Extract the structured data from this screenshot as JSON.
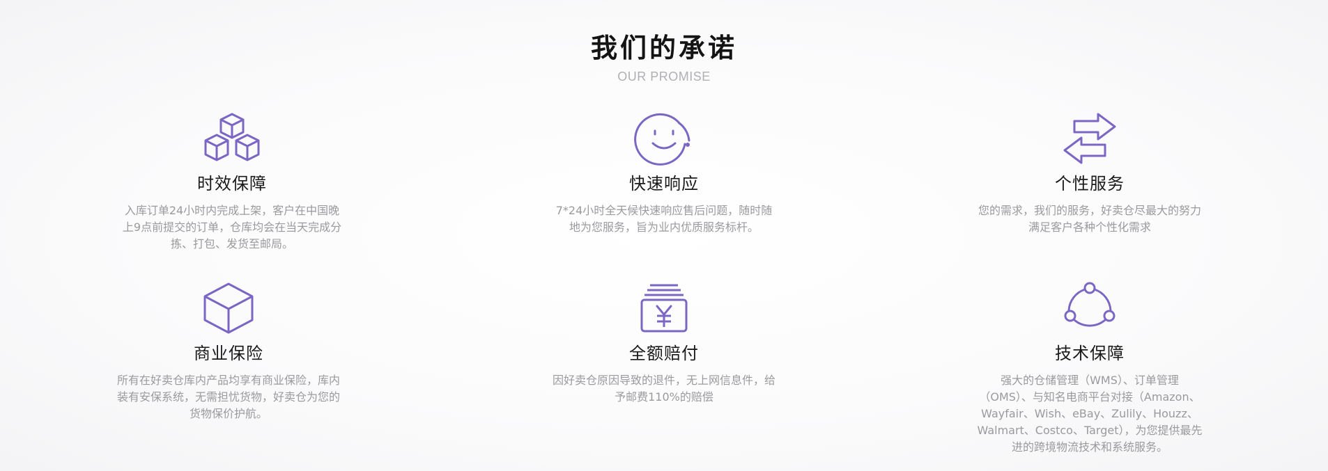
{
  "header": {
    "title": "我们的承诺",
    "subtitle": "OUR PROMISE"
  },
  "accent_color": "#7b66c4",
  "cards": [
    {
      "icon": "cubes-icon",
      "title": "时效保障",
      "description": "入库订单24小时内完成上架，客户在中国晚上9点前提交的订单，仓库均会在当天完成分拣、打包、发货至邮局。"
    },
    {
      "icon": "smiley-face-icon",
      "title": "快速响应",
      "description": "7*24小时全天候快速响应售后问题，随时随地为您服务，旨为业内优质服务标杆。"
    },
    {
      "icon": "exchange-arrows-icon",
      "title": "个性服务",
      "description": "您的需求，我们的服务，好卖仓尽最大的努力满足客户各种个性化需求"
    },
    {
      "icon": "box-icon",
      "title": "商业保险",
      "description": "所有在好卖仓库内产品均享有商业保险，库内装有安保系统，无需担忧货物，好卖仓为您的货物保价护航。"
    },
    {
      "icon": "yuan-money-icon",
      "title": "全额赔付",
      "description": "因好卖仓原因导致的退件，无上网信息件，给予邮费110%的赔偿"
    },
    {
      "icon": "network-nodes-icon",
      "title": "技术保障",
      "description": "强大的仓储管理（WMS）、订单管理（OMS）、与知名电商平台对接（Amazon、Wayfair、Wish、eBay、Zulily、Houzz、Walmart、Costco、Target），为您提供最先进的跨境物流技术和系统服务。"
    }
  ]
}
